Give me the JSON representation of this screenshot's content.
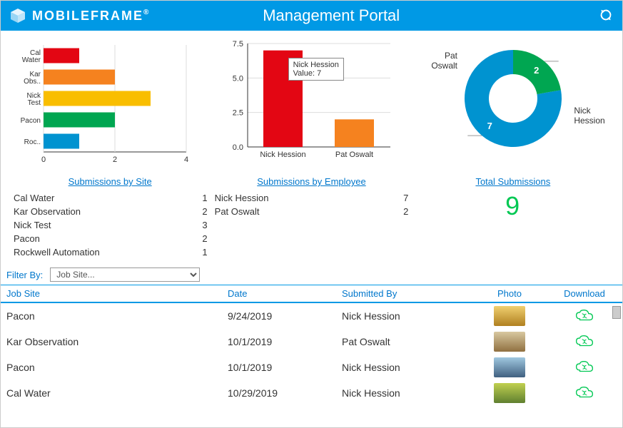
{
  "header": {
    "brand": "MOBILEFRAME",
    "title": "Management Portal"
  },
  "chart_data": [
    {
      "type": "bar",
      "orientation": "horizontal",
      "categories": [
        "Cal Water",
        "Kar Obs..",
        "Nick Test",
        "Pacon",
        "Roc.."
      ],
      "values": [
        1,
        2,
        3,
        2,
        1
      ],
      "colors": [
        "#e30613",
        "#f5821f",
        "#f9be00",
        "#00a651",
        "#0093d0"
      ],
      "xlim": [
        0,
        4
      ],
      "xticks": [
        0,
        2,
        4
      ]
    },
    {
      "type": "bar",
      "orientation": "vertical",
      "categories": [
        "Nick Hession",
        "Pat Oswalt"
      ],
      "values": [
        7,
        2
      ],
      "colors": [
        "#e30613",
        "#f5821f"
      ],
      "ylim": [
        0,
        7.5
      ],
      "yticks": [
        0.0,
        2.5,
        5.0,
        7.5
      ],
      "tooltip": {
        "label": "Nick Hession",
        "value_text": "Value: 7",
        "index": 0
      }
    },
    {
      "type": "pie",
      "donut": true,
      "series": [
        {
          "name": "Nick Hession",
          "value": 7,
          "color": "#0093d0",
          "data_label": "7"
        },
        {
          "name": "Pat Oswalt",
          "value": 2,
          "color": "#00a651",
          "data_label": "2"
        }
      ]
    }
  ],
  "captions": {
    "site": "Submissions by Site",
    "employee": "Submissions by Employee",
    "total": "Total Submissions"
  },
  "site_table": [
    {
      "name": "Cal Water",
      "count": 1
    },
    {
      "name": "Kar Observation",
      "count": 2
    },
    {
      "name": "Nick Test",
      "count": 3
    },
    {
      "name": "Pacon",
      "count": 2
    },
    {
      "name": "Rockwell Automation",
      "count": 1
    }
  ],
  "employee_table": [
    {
      "name": "Nick Hession",
      "count": 7
    },
    {
      "name": "Pat Oswalt",
      "count": 2
    }
  ],
  "total_submissions": 9,
  "filter": {
    "label": "Filter By:",
    "placeholder": "Job Site..."
  },
  "grid": {
    "columns": [
      "Job Site",
      "Date",
      "Submitted By",
      "Photo",
      "Download"
    ],
    "rows": [
      {
        "site": "Pacon",
        "date": "9/24/2019",
        "by": "Nick Hession",
        "thumb_bg": "linear-gradient(#f0d070,#b08020)"
      },
      {
        "site": "Kar Observation",
        "date": "10/1/2019",
        "by": "Pat Oswalt",
        "thumb_bg": "linear-gradient(#d8c8a0,#907040)"
      },
      {
        "site": "Pacon",
        "date": "10/1/2019",
        "by": "Nick Hession",
        "thumb_bg": "linear-gradient(#a0c8e0,#406080)"
      },
      {
        "site": "Cal Water",
        "date": "10/29/2019",
        "by": "Nick Hession",
        "thumb_bg": "linear-gradient(#c0d050,#608030)"
      }
    ]
  }
}
